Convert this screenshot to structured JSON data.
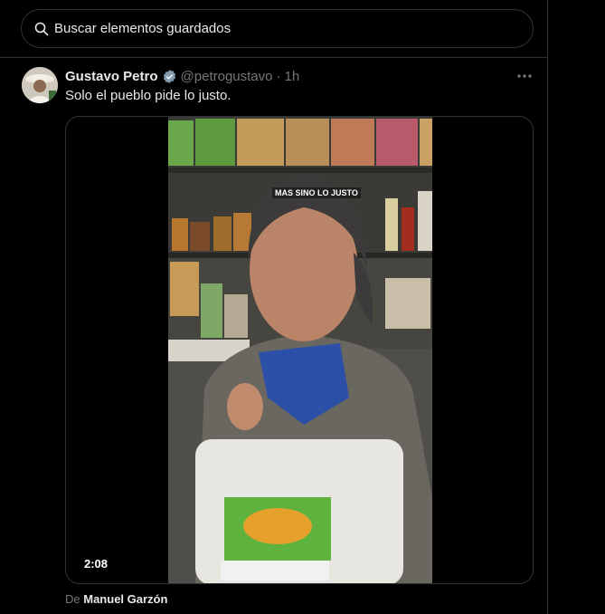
{
  "search": {
    "placeholder": "Buscar elementos guardados"
  },
  "tweet": {
    "author_name": "Gustavo Petro",
    "handle": "@petrogustavo",
    "separator": "·",
    "time": "1h",
    "text": "Solo el pueblo pide lo justo.",
    "media": {
      "duration": "2:08",
      "overlay_caption": "MAS SINO LO JUSTO"
    },
    "attribution_prefix": "De",
    "attribution_name": "Manuel Garzón"
  },
  "colors": {
    "background": "#000000",
    "border": "#2f3336",
    "text": "#e7e9ea",
    "muted": "#71767b",
    "verified": "#829aab"
  },
  "icons": {
    "search": "search-icon",
    "verified": "verified-badge-icon",
    "more": "more-icon"
  }
}
